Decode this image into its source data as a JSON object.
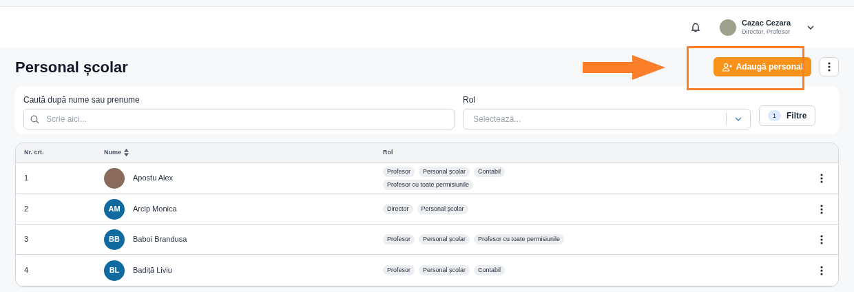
{
  "header": {
    "user_name": "Cazac Cezara",
    "user_roles": "Director, Profesor"
  },
  "page": {
    "title": "Personal școlar",
    "add_button": "Adaugă personal"
  },
  "filters": {
    "search_label": "Caută după nume sau prenume",
    "search_placeholder": "Scrie aici...",
    "role_label": "Rol",
    "role_placeholder": "Selectează...",
    "filter_count": "1",
    "filter_button": "Filtre"
  },
  "table": {
    "columns": [
      "Nr. crt.",
      "Nume",
      "Rol"
    ],
    "rows": [
      {
        "number": "1",
        "name": "Apostu Alex",
        "kind": "photo",
        "roles": [
          "Profesor",
          "Personal școlar",
          "Contabil",
          "Profesor cu toate permisiunile"
        ]
      },
      {
        "number": "2",
        "name": "Arcip Monica",
        "kind": "initials",
        "initials": "AM",
        "roles": [
          "Director",
          "Personal școlar"
        ]
      },
      {
        "number": "3",
        "name": "Baboi Brandusa",
        "kind": "initials",
        "initials": "BB",
        "roles": [
          "Profesor",
          "Personal școlar",
          "Profesor cu toate permisiunile"
        ]
      },
      {
        "number": "4",
        "name": "Badiță Liviu",
        "kind": "initials",
        "initials": "BL",
        "roles": [
          "Profesor",
          "Personal școlar",
          "Contabil"
        ]
      }
    ]
  }
}
